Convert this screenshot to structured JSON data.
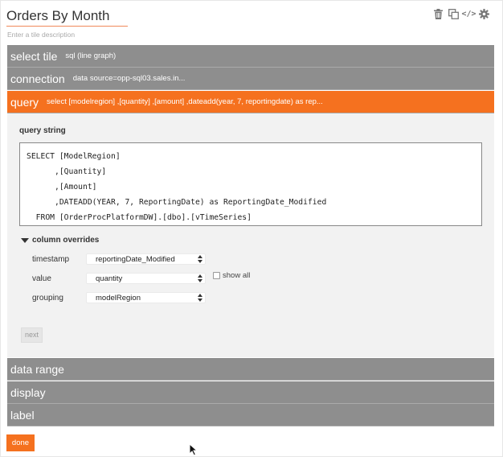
{
  "tile": {
    "title": "Orders By Month",
    "description_placeholder": "Enter a tile description"
  },
  "toolbar": {
    "icons": [
      "trash-icon",
      "copy-icon",
      "code-icon",
      "gear-icon"
    ],
    "code_glyph": "</>"
  },
  "panels": {
    "select_tile": {
      "name": "select tile",
      "summary": "sql (line graph)"
    },
    "connection": {
      "name": "connection",
      "summary": "data source=opp-sql03.sales.in..."
    },
    "query": {
      "name": "query",
      "summary": "select [modelregion] ,[quantity] ,[amount] ,dateadd(year, 7, reportingdate) as rep..."
    },
    "data_range": {
      "name": "data range"
    },
    "display": {
      "name": "display"
    },
    "label": {
      "name": "label"
    }
  },
  "query": {
    "query_string_label": "query string",
    "lines": [
      "SELECT [ModelRegion]",
      "      ,[Quantity]",
      "      ,[Amount]",
      "      ,DATEADD(YEAR, 7, ReportingDate) as ReportingDate_Modified",
      "  FROM [OrderProcPlatformDW].[dbo].[vTimeSeries]"
    ],
    "column_overrides_label": "column overrides",
    "fields": [
      {
        "label": "timestamp",
        "value": "reportingDate_Modified"
      },
      {
        "label": "value",
        "value": "quantity"
      },
      {
        "label": "grouping",
        "value": "modelRegion"
      }
    ],
    "show_all_label": "show all",
    "next_label": "next"
  },
  "done_label": "done",
  "colors": {
    "accent": "#f5711f",
    "panel_gray": "#8e8e8e",
    "body_bg": "#f2f2f2"
  }
}
